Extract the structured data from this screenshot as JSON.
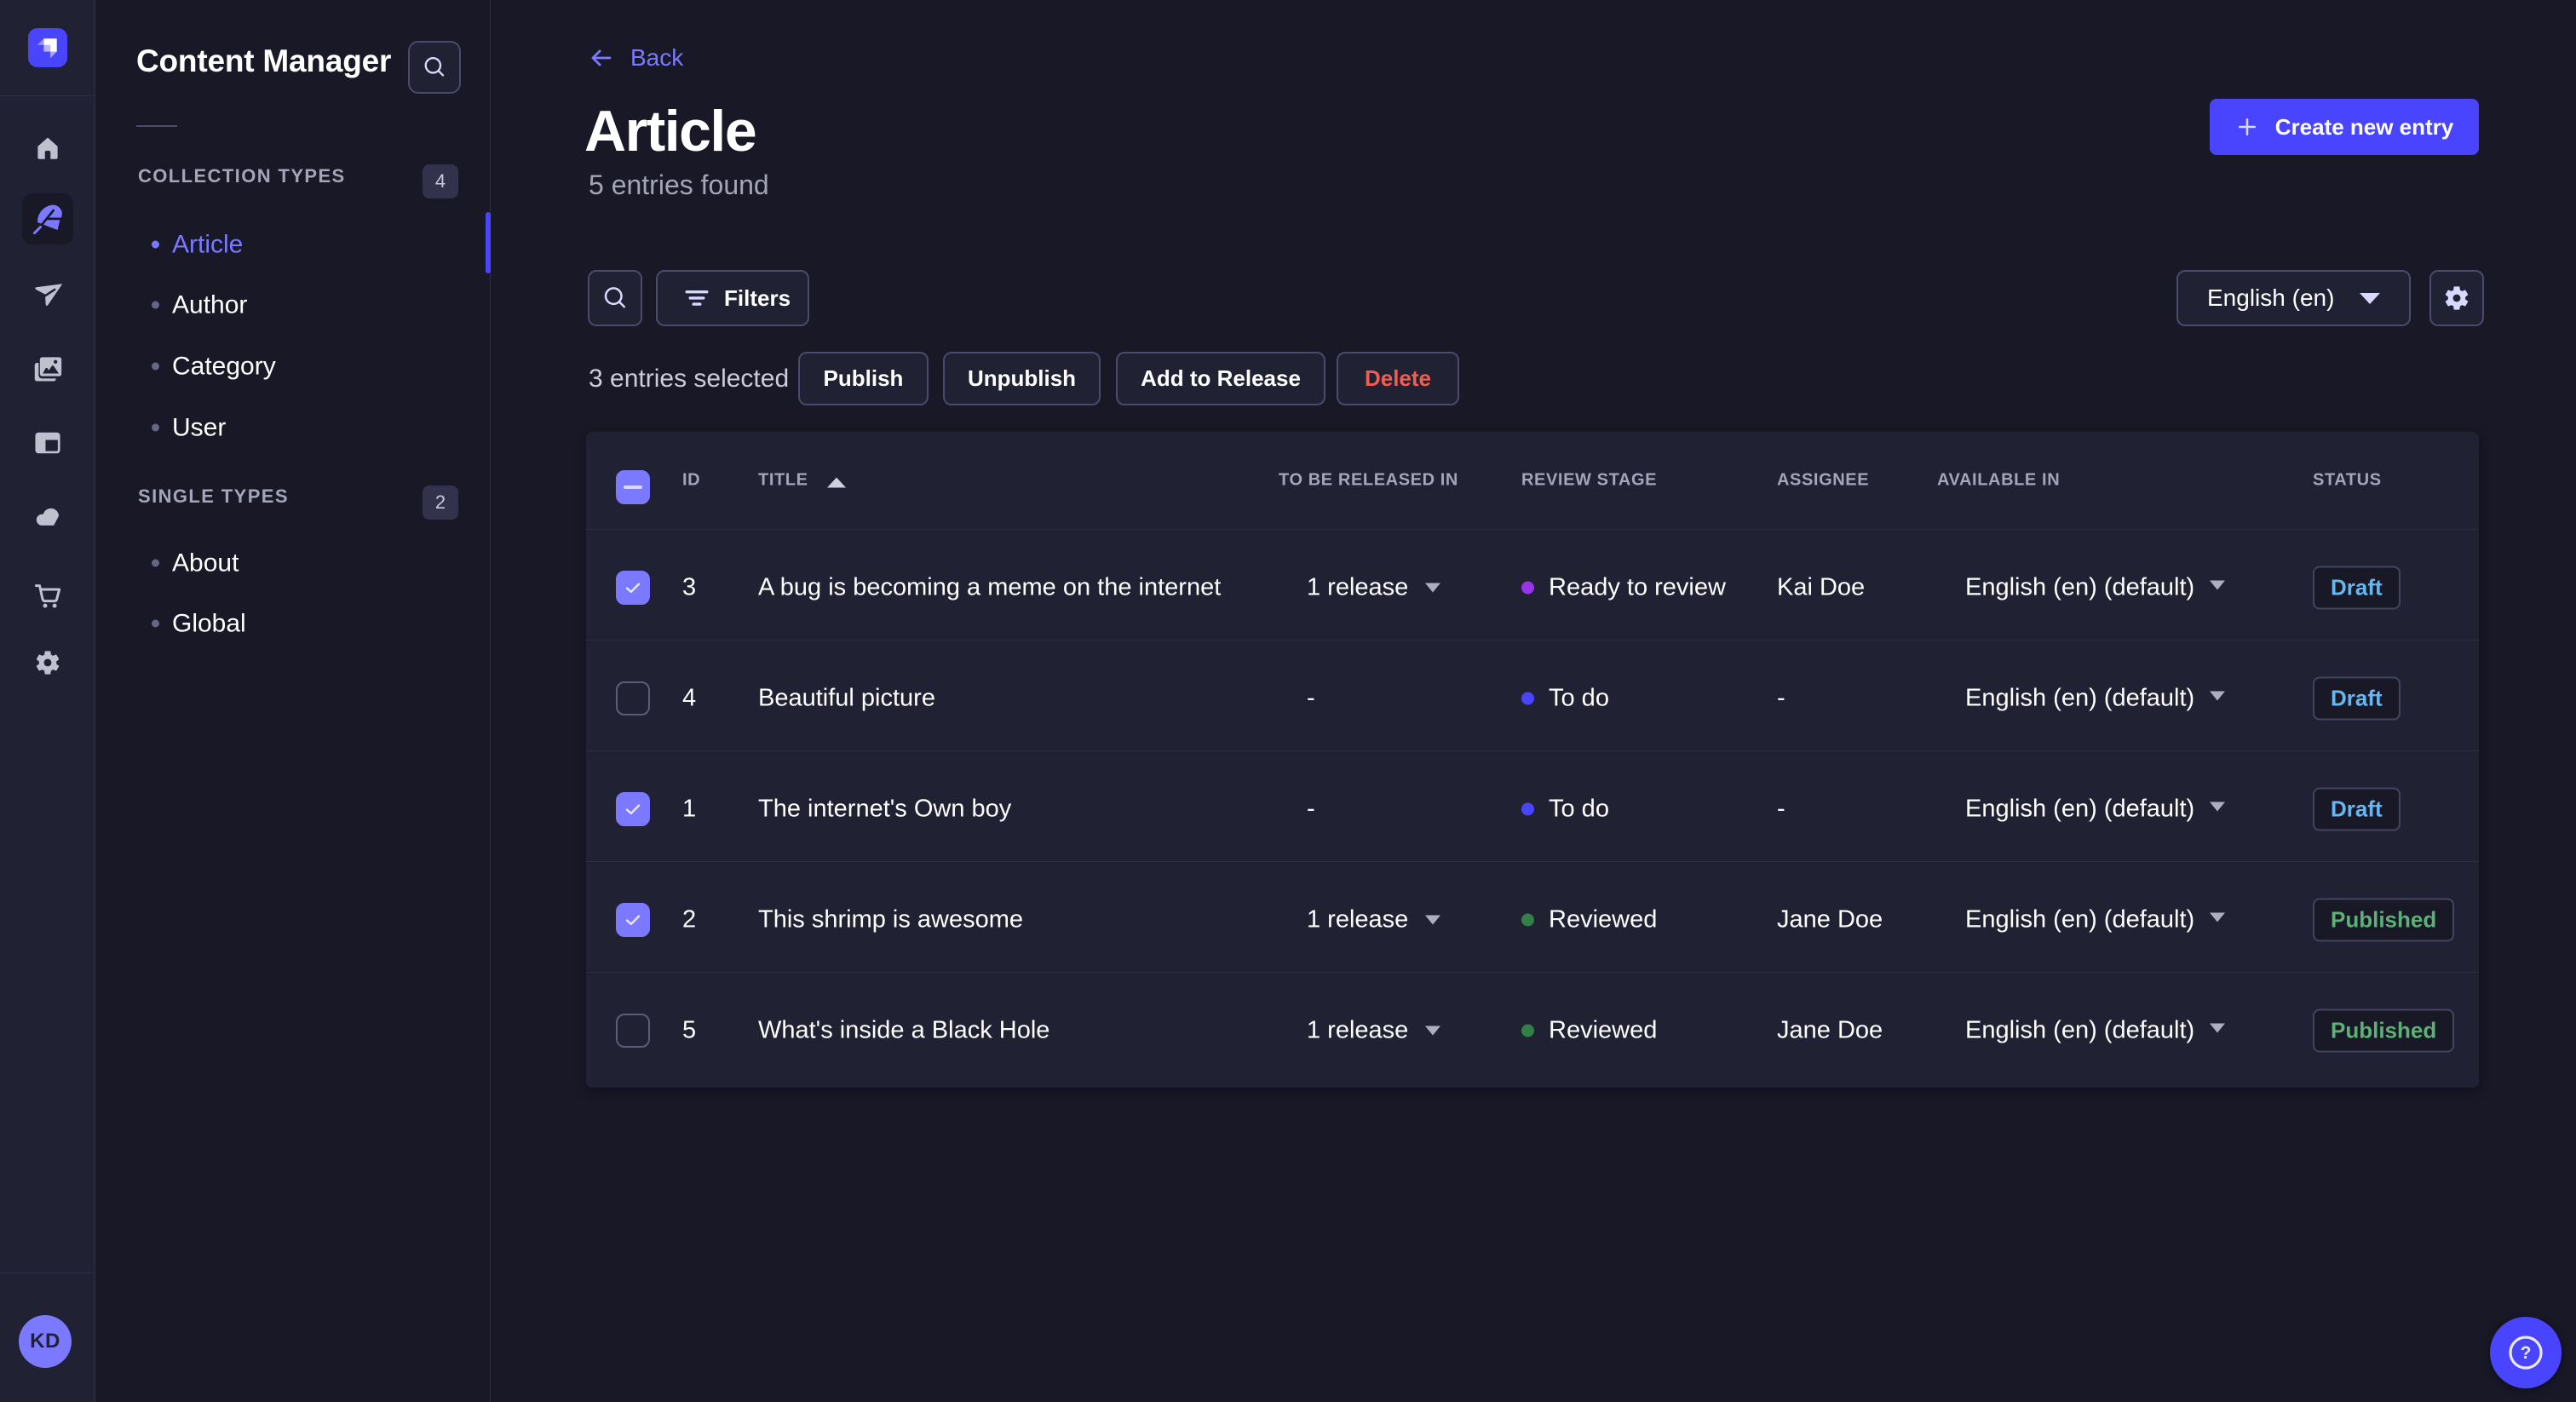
{
  "colors": {
    "primary": "#4945ff",
    "primary_light": "#7b79ff",
    "page_bg": "#181826",
    "card_bg": "#212134",
    "danger": "#ee5e52",
    "draft": "#66b7f1",
    "published": "#5cb176"
  },
  "rail": {
    "icons": [
      "home",
      "feather",
      "paper-plane",
      "images",
      "layout",
      "cloud",
      "shopping-cart",
      "gear"
    ],
    "active_icon": "feather",
    "avatar_initials": "KD"
  },
  "subnav": {
    "title": "Content Manager",
    "sections": [
      {
        "label": "COLLECTION TYPES",
        "count": "4",
        "items": [
          {
            "label": "Article",
            "active": true
          },
          {
            "label": "Author",
            "active": false
          },
          {
            "label": "Category",
            "active": false
          },
          {
            "label": "User",
            "active": false
          }
        ]
      },
      {
        "label": "SINGLE TYPES",
        "count": "2",
        "items": [
          {
            "label": "About",
            "active": false
          },
          {
            "label": "Global",
            "active": false
          }
        ]
      }
    ]
  },
  "header": {
    "back_label": "Back",
    "title": "Article",
    "subtitle": "5 entries found",
    "create_button": "Create new entry"
  },
  "toolbar": {
    "filters_label": "Filters",
    "locale_value": "English (en)"
  },
  "selection": {
    "text": "3 entries selected",
    "publish": "Publish",
    "unpublish": "Unpublish",
    "add_to_release": "Add to Release",
    "delete": "Delete"
  },
  "table": {
    "headers": {
      "id": "ID",
      "title": "TITLE",
      "release": "TO BE RELEASED IN",
      "stage": "REVIEW STAGE",
      "assignee": "ASSIGNEE",
      "available": "AVAILABLE IN",
      "status": "STATUS"
    },
    "rows": [
      {
        "checked": true,
        "id": "3",
        "title": "A bug is becoming a meme on the internet",
        "release": "1 release",
        "has_release_menu": true,
        "stage": "Ready to review",
        "stage_color": "#9736e8",
        "assignee": "Kai Doe",
        "available": "English (en) (default)",
        "status": "Draft"
      },
      {
        "checked": false,
        "id": "4",
        "title": "Beautiful picture",
        "release": "-",
        "has_release_menu": false,
        "stage": "To do",
        "stage_color": "#4945ff",
        "assignee": "-",
        "available": "English (en) (default)",
        "status": "Draft"
      },
      {
        "checked": true,
        "id": "1",
        "title": "The internet's Own boy",
        "release": "-",
        "has_release_menu": false,
        "stage": "To do",
        "stage_color": "#4945ff",
        "assignee": "-",
        "available": "English (en) (default)",
        "status": "Draft"
      },
      {
        "checked": true,
        "id": "2",
        "title": "This shrimp is awesome",
        "release": "1 release",
        "has_release_menu": true,
        "stage": "Reviewed",
        "stage_color": "#328048",
        "assignee": "Jane Doe",
        "available": "English (en) (default)",
        "status": "Published"
      },
      {
        "checked": false,
        "id": "5",
        "title": "What's inside a Black Hole",
        "release": "1 release",
        "has_release_menu": true,
        "stage": "Reviewed",
        "stage_color": "#328048",
        "assignee": "Jane Doe",
        "available": "English (en) (default)",
        "status": "Published"
      }
    ]
  },
  "help": {
    "icon": "question-mark",
    "glyph": "?"
  }
}
